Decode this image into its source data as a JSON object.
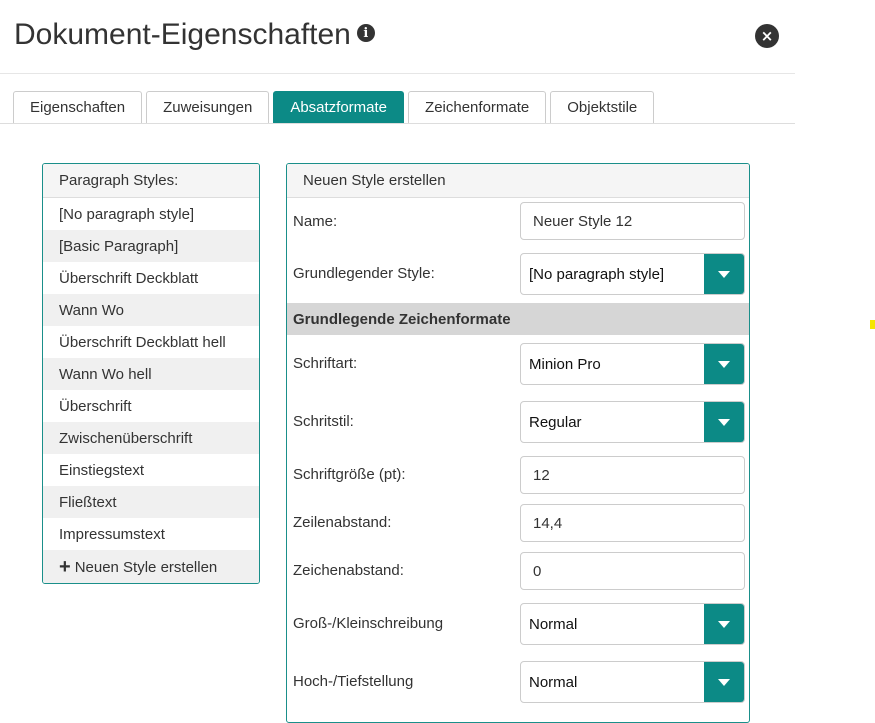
{
  "dialog": {
    "title": "Dokument-Eigenschaften",
    "info_icon": "i",
    "close_icon": "×"
  },
  "tabs": [
    {
      "label": "Eigenschaften",
      "active": false
    },
    {
      "label": "Zuweisungen",
      "active": false
    },
    {
      "label": "Absatzformate",
      "active": true
    },
    {
      "label": "Zeichenformate",
      "active": false
    },
    {
      "label": "Objektstile",
      "active": false
    }
  ],
  "styles_panel": {
    "header": "Paragraph Styles:",
    "items": [
      "[No paragraph style]",
      "[Basic Paragraph]",
      "Überschrift Deckblatt",
      "Wann Wo",
      "Überschrift Deckblatt hell",
      "Wann Wo hell",
      "Überschrift",
      "Zwischenüberschrift",
      "Einstiegstext",
      "Fließtext",
      "Impressumstext"
    ],
    "new_style_icon": "+",
    "new_style_label": "Neuen Style erstellen"
  },
  "form": {
    "header": "Neuen Style erstellen",
    "name_label": "Name:",
    "name_value": "Neuer Style 12",
    "base_style_label": "Grundlegender Style:",
    "base_style_value": "[No paragraph style]",
    "section_title": "Grundlegende Zeichenformate",
    "font_label": "Schriftart:",
    "font_value": "Minion Pro",
    "font_style_label": "Schritstil:",
    "font_style_value": "Regular",
    "font_size_label": "Schriftgröße (pt):",
    "font_size_value": "12",
    "leading_label": "Zeilenabstand:",
    "leading_value": "14,4",
    "tracking_label": "Zeichenabstand:",
    "tracking_value": "0",
    "case_label": "Groß-/Kleinschreibung",
    "case_value": "Normal",
    "position_label": "Hoch-/Tiefstellung",
    "position_value": "Normal"
  },
  "colors": {
    "accent": "#0c8a86",
    "section_bar": "#d6d6d6",
    "alt_row": "#f0f0f0"
  }
}
